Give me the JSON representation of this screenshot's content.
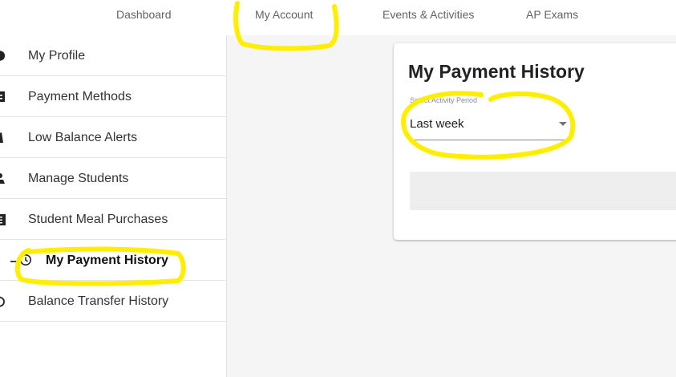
{
  "topnav": {
    "items": [
      {
        "label": "Dashboard"
      },
      {
        "label": "My Account"
      },
      {
        "label": "Events & Activities"
      },
      {
        "label": "AP Exams"
      }
    ]
  },
  "sidebar": {
    "items": [
      {
        "label": "My Profile",
        "icon": "profile-icon"
      },
      {
        "label": "Payment Methods",
        "icon": "payment-methods-icon"
      },
      {
        "label": "Low Balance Alerts",
        "icon": "alert-icon"
      },
      {
        "label": "Manage Students",
        "icon": "students-icon"
      },
      {
        "label": "Student Meal Purchases",
        "icon": "receipt-icon"
      },
      {
        "label": "My Payment History",
        "icon": "history-icon",
        "active": true
      },
      {
        "label": "Balance Transfer History",
        "icon": "transfer-history-icon"
      }
    ]
  },
  "card": {
    "title": "My Payment History",
    "select": {
      "label": "Select Activity Period",
      "value": "Last week"
    }
  },
  "colors": {
    "highlight": "#ffee00",
    "main_background": "#f5f5f5",
    "nav_text": "#5f6368"
  }
}
